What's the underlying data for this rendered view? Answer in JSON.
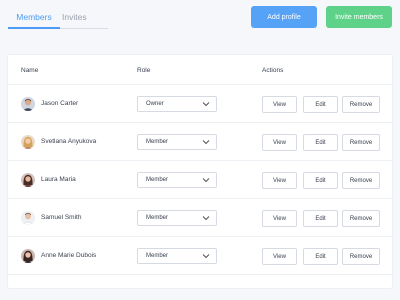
{
  "tabs": [
    {
      "label": "Members",
      "active": true
    },
    {
      "label": "Invites",
      "active": false
    }
  ],
  "buttons": {
    "add_profile": "Add profile",
    "invite_members": "Invite members"
  },
  "table": {
    "headers": {
      "name": "Name",
      "role": "Role",
      "actions": "Actions"
    },
    "rows": [
      {
        "name": "Jason Carter",
        "role": "Owner",
        "avatar_icon": "avatar-man-icon"
      },
      {
        "name": "Svetlana Anyukova",
        "role": "Member",
        "avatar_icon": "avatar-woman-icon"
      },
      {
        "name": "Laura Maria",
        "role": "Member",
        "avatar_icon": "avatar-woman-icon"
      },
      {
        "name": "Samuel Smith",
        "role": "Member",
        "avatar_icon": "avatar-man-icon"
      },
      {
        "name": "Anne Marie Dubois",
        "role": "Member",
        "avatar_icon": "avatar-woman-icon"
      }
    ],
    "actions": {
      "view": "View",
      "edit": "Edit",
      "remove": "Remove"
    }
  },
  "colors": {
    "accent_blue": "#4d9bf7",
    "add_button": "#55a2f7",
    "invite_button": "#5fd28a",
    "background": "#f5f7fb"
  }
}
